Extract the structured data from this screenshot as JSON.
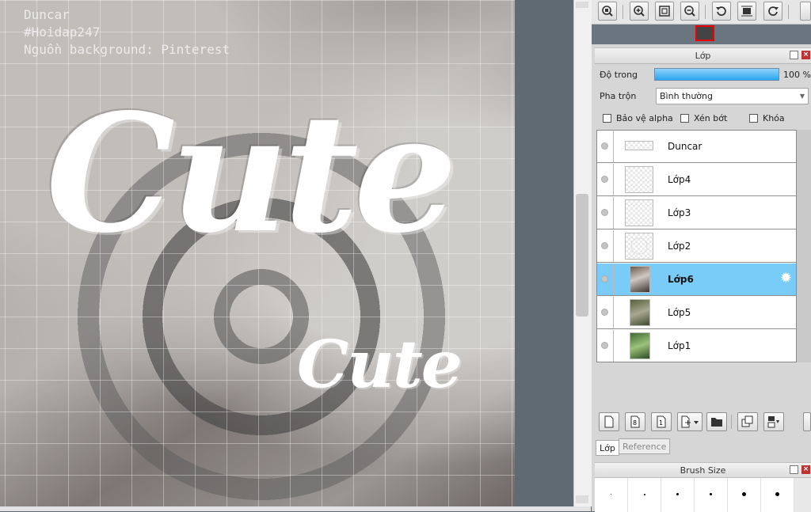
{
  "canvas": {
    "credit_lines": [
      "Duncar",
      "#Hoidap247",
      "Nguồn background: Pinterest"
    ],
    "big_text": "Cute",
    "small_text": "Cute"
  },
  "navigator": {
    "buttons": [
      "zoom-fit-icon",
      "zoom-in-icon",
      "fit-window-icon",
      "zoom-out-icon",
      "rotate-left-icon",
      "actual-size-icon",
      "rotate-right-icon"
    ]
  },
  "layer_panel": {
    "title": "Lớp",
    "opacity_label": "Độ trong",
    "opacity_value": "100 %",
    "opacity_fraction": 1.0,
    "blend_label": "Pha trộn",
    "blend_value": "Bình thường",
    "protect_alpha": "Bảo vệ alpha",
    "clipping": "Xén bớt",
    "lock": "Khóa",
    "layers": [
      {
        "name": "Duncar",
        "selected": false
      },
      {
        "name": "Lớp4",
        "selected": false
      },
      {
        "name": "Lớp3",
        "selected": false
      },
      {
        "name": "Lớp2",
        "selected": false
      },
      {
        "name": "Lớp6",
        "selected": true
      },
      {
        "name": "Lớp5",
        "selected": false
      },
      {
        "name": "Lớp1",
        "selected": false
      }
    ],
    "tab_layer": "Lớp",
    "tab_reference": "Reference"
  },
  "brush_panel": {
    "title": "Brush Size"
  },
  "colors": {
    "selected_row": "#79ccf7",
    "opacity_bar": "#2aa5ef",
    "highlight_border": "#e00000"
  }
}
